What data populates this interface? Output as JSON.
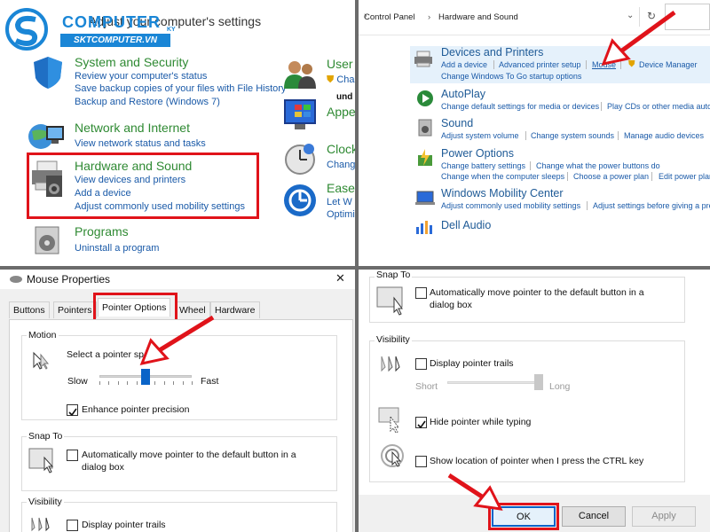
{
  "panel1": {
    "header_text": "Adjust your computer's settings",
    "watermark": {
      "main": "COMPUTER",
      "sub": "SKTCOMPUTER.VN",
      "tag": "KY"
    },
    "categories": [
      {
        "title": "System and Security",
        "links": [
          "Review your computer's status",
          "Save backup copies of your files with File History",
          "Backup and Restore (Windows 7)"
        ]
      },
      {
        "title": "Network and Internet",
        "links": [
          "View network status and tasks"
        ]
      },
      {
        "title": "Hardware and Sound",
        "links": [
          "View devices and printers",
          "Add a device",
          "Adjust commonly used mobility settings"
        ]
      },
      {
        "title": "Programs",
        "links": [
          "Uninstall a program"
        ]
      }
    ],
    "right_categories": [
      {
        "title": "User",
        "link": "Chan"
      },
      {
        "title": "Appe",
        "link": ""
      },
      {
        "title": "Clock",
        "link": "Chang"
      },
      {
        "title": "Ease o",
        "link": "Let W",
        "link2": "Optimi"
      }
    ],
    "cut_text": "und"
  },
  "panel2": {
    "breadcrumb": [
      "Control Panel",
      "Hardware and Sound"
    ],
    "items": [
      {
        "title": "Devices and Printers",
        "links": [
          "Add a device",
          "Advanced printer setup",
          "Mouse",
          "Device Manager"
        ],
        "links2": [
          "Change Windows To Go startup options"
        ]
      },
      {
        "title": "AutoPlay",
        "links": [
          "Change default settings for media or devices",
          "Play CDs or other media autom"
        ]
      },
      {
        "title": "Sound",
        "links": [
          "Adjust system volume",
          "Change system sounds",
          "Manage audio devices"
        ]
      },
      {
        "title": "Power Options",
        "links": [
          "Change battery settings",
          "Change what the power buttons do"
        ],
        "links2": [
          "Change when the computer sleeps",
          "Choose a power plan",
          "Edit power plan"
        ]
      },
      {
        "title": "Windows Mobility Center",
        "links": [
          "Adjust commonly used mobility settings",
          "Adjust settings before giving a pres"
        ]
      },
      {
        "title": "Dell Audio",
        "links": []
      }
    ]
  },
  "panel3": {
    "window_title": "Mouse Properties",
    "close": "✕",
    "tabs": [
      "Buttons",
      "Pointers",
      "Pointer Options",
      "Wheel",
      "Hardware"
    ],
    "motion": {
      "label": "Motion",
      "speed_label": "Select a pointer speed:",
      "slow": "Slow",
      "fast": "Fast",
      "speed_value": 0.5,
      "enhance": "Enhance pointer precision",
      "enhance_checked": true
    },
    "snap": {
      "label": "Snap To",
      "text1": "Automatically move pointer to the default button in a",
      "text2": "dialog box"
    },
    "visibility": {
      "label": "Visibility",
      "trails": "Display pointer trails"
    }
  },
  "panel4": {
    "snap": {
      "label": "Snap To",
      "text1": "Automatically move pointer to the default button in a",
      "text2": "dialog box"
    },
    "visibility": {
      "label": "Visibility",
      "trails": "Display pointer trails",
      "short": "Short",
      "long": "Long",
      "trail_value": 1.0,
      "hide": "Hide pointer while typing",
      "hide_checked": true,
      "ctrl": "Show location of pointer when I press the CTRL key"
    },
    "buttons": {
      "ok": "OK",
      "cancel": "Cancel",
      "apply": "Apply"
    }
  },
  "colors": {
    "highlight": "#e0131a",
    "link": "#1a5aa8",
    "category": "#2f8a33"
  }
}
